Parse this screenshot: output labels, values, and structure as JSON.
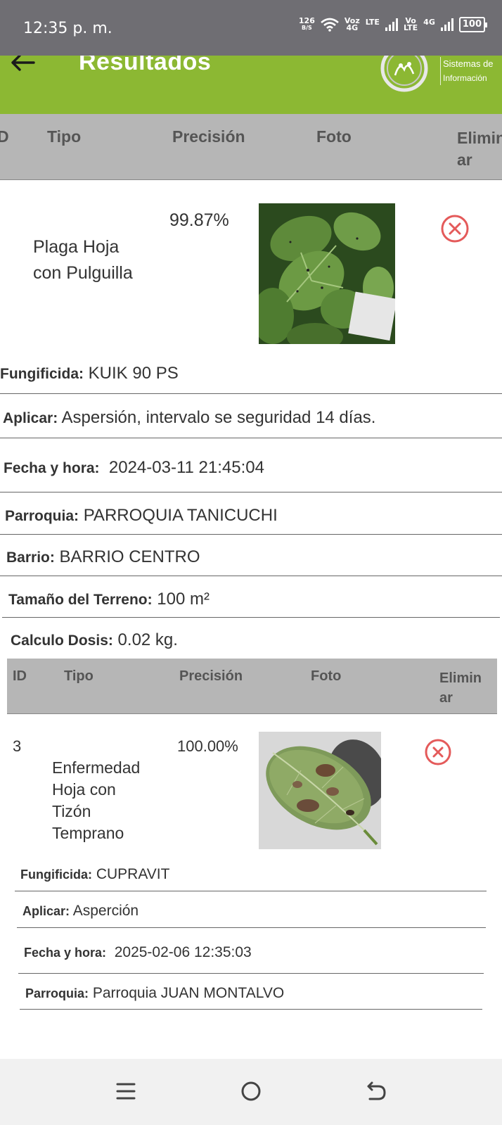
{
  "status_bar": {
    "time": "12:35 p. m.",
    "net_speed_value": "126",
    "net_speed_unit": "B/S",
    "sim1_top": "Voz",
    "sim1_bottom": "4G",
    "sim1_lte": "LTE",
    "sim2_top": "Vo",
    "sim2_bottom": "LTE",
    "sim2_net": "4G",
    "battery": "100"
  },
  "app_bar": {
    "title": "Resultados",
    "logo_line1": "Sistemas de",
    "logo_line2": "Información"
  },
  "table_header_1": {
    "id": "D",
    "tipo": "Tipo",
    "precision": "Precisión",
    "foto": "Foto",
    "eliminar_1": "Elimin",
    "eliminar_2": "ar"
  },
  "result_1": {
    "tipo_1": "Plaga Hoja",
    "tipo_2": "con Pulguilla",
    "precision": "99.87%",
    "fungicida_label": "Fungificida:",
    "fungicida": "KUIK 90 PS",
    "aplicar_label": "Aplicar:",
    "aplicar": "Aspersión, intervalo se seguridad 14 días.",
    "fecha_label": "Fecha y hora:",
    "fecha": "2024-03-11 21:45:04",
    "parroquia_label": "Parroquia:",
    "parroquia": "PARROQUIA TANICUCHI",
    "barrio_label": "Barrio:",
    "barrio": "BARRIO CENTRO",
    "terreno_label": "Tamaño del Terreno:",
    "terreno": "100 m²",
    "dosis_label": "Calculo Dosis:",
    "dosis": "0.02 kg."
  },
  "table_header_2": {
    "id": "ID",
    "tipo": "Tipo",
    "precision": "Precisión",
    "foto": "Foto",
    "eliminar_1": "Elimin",
    "eliminar_2": "ar"
  },
  "result_2": {
    "id": "3",
    "tipo_1": "Enfermedad",
    "tipo_2": "Hoja con",
    "tipo_3": "Tizón",
    "tipo_4": "Temprano",
    "precision": "100.00%",
    "fungicida_label": "Fungificida:",
    "fungicida": "CUPRAVIT",
    "aplicar_label": "Aplicar:",
    "aplicar": "Asperción",
    "fecha_label": "Fecha y hora:",
    "fecha": "2025-02-06 12:35:03",
    "parroquia_label": "Parroquia:",
    "parroquia": "Parroquia JUAN MONTALVO"
  },
  "colors": {
    "app_bar": "#8cb833",
    "status_bar": "#6f6e73",
    "table_header": "#b6b6b6",
    "delete_icon": "#e45a5a"
  },
  "icons": {
    "back": "arrow-left-icon",
    "delete": "circle-x-icon",
    "nav_recents": "menu-lines-icon",
    "nav_home": "circle-icon",
    "nav_back": "return-arrow-icon"
  }
}
